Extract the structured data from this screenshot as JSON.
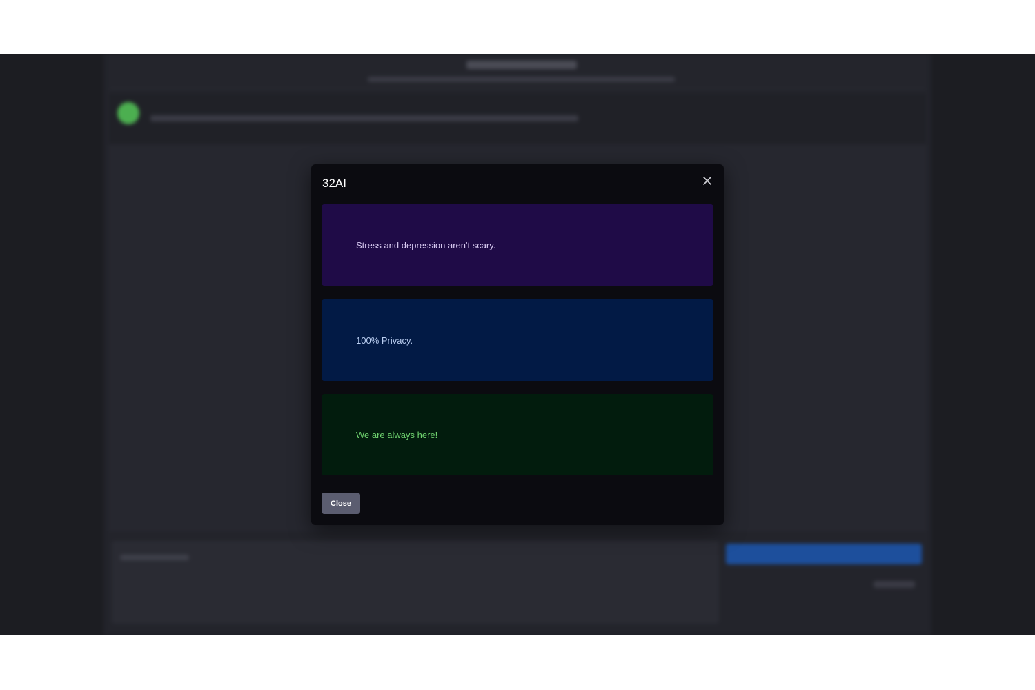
{
  "modal": {
    "title": "32AI",
    "close_icon": "close-icon",
    "close_button_label": "Close",
    "cards": [
      {
        "text": "Stress and depression aren't scary.",
        "background": "#1f0b47",
        "text_color": "#d9ccf2"
      },
      {
        "text": "100% Privacy.",
        "background": "#021a45",
        "text_color": "#b9cdf0"
      },
      {
        "text": "We are always here!",
        "background": "#021c0d",
        "text_color": "#6fd36f"
      }
    ]
  },
  "colors": {
    "backdrop": "#1c1d22",
    "modal_background": "#0b0b10",
    "close_button": "#5b5d70",
    "avatar": "#4caf50",
    "send_button": "#1d4f9c"
  }
}
